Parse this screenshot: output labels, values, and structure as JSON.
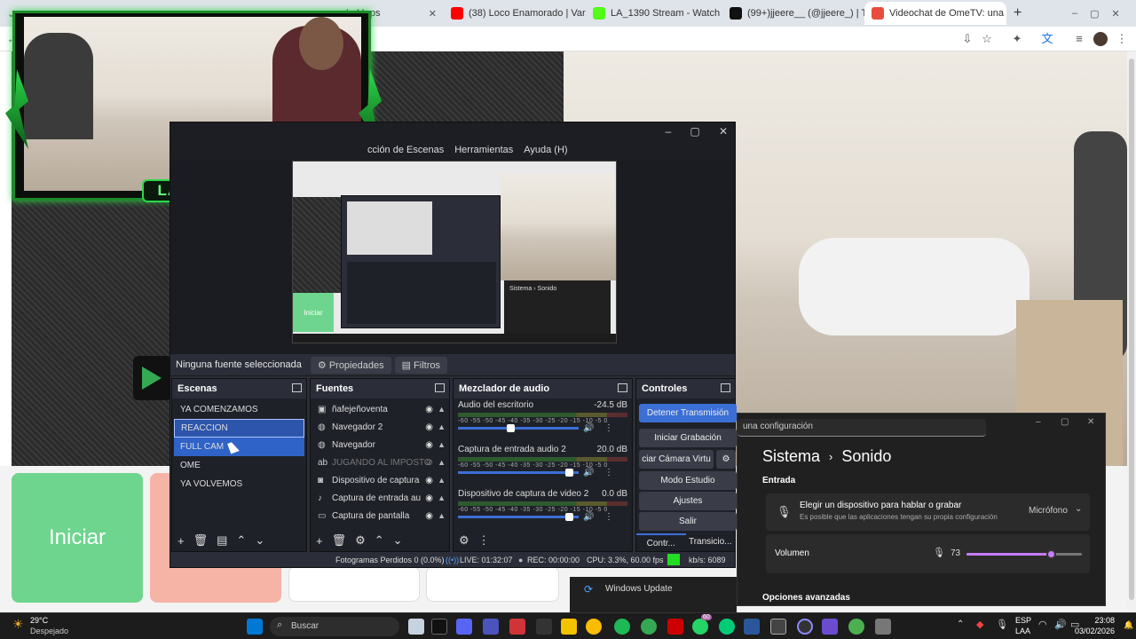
{
  "browser": {
    "tabs": [
      {
        "label": "le Maps",
        "color": "#1a73e8"
      },
      {
        "label": "(38) Loco Enamorado | Varieté",
        "color": "#ff0000"
      },
      {
        "label": "LA_1390 Stream - Watch Live o",
        "color": "#53fc18"
      },
      {
        "label": "(99+)jjeere__ (@jjeere_) | TikTo",
        "color": "#111111"
      },
      {
        "label": "Videochat de OmeTV: una",
        "color": "#e94b3c"
      }
    ],
    "new_tab": "+"
  },
  "page": {
    "iniciar_label": "Iniciar",
    "overlay_name": "LA_1390"
  },
  "obs": {
    "menu": [
      "cción de Escenas",
      "Herramientas",
      "Ayuda (H)"
    ],
    "preview_button": "Iniciar",
    "preview_window_title": "Sistema",
    "preview_window_page": "Sonido",
    "source_toolbar": {
      "none_selected": "Ninguna fuente seleccionada",
      "properties": "Propiedades",
      "filters": "Filtros"
    },
    "scenes": {
      "title": "Escenas",
      "items": [
        "YA COMENZAMOS",
        "REACCION",
        "FULL CAM",
        "OME",
        "YA VOLVEMOS"
      ]
    },
    "sources": {
      "title": "Fuentes",
      "items": [
        "ñafejeñoventa",
        "Navegador 2",
        "Navegador",
        "JUGANDO AL IMPOSTO",
        "Dispositivo de captura",
        "Captura de entrada au",
        "Captura de pantalla"
      ]
    },
    "mixer": {
      "title": "Mezclador de audio",
      "scale": "-60 -55 -50 -45 -40 -35 -30 -25 -20 -15 -10 -5 0",
      "channels": [
        {
          "name": "Audio del escritorio",
          "db": "-24.5 dB",
          "level": 0.43
        },
        {
          "name": "Captura de entrada audio 2",
          "db": "20.0 dB",
          "level": 0.95
        },
        {
          "name": "Dispositivo de captura de video 2",
          "db": "0.0 dB",
          "level": 0.95
        }
      ]
    },
    "controls": {
      "title": "Controles",
      "stop_stream": "Detener Transmisión",
      "start_recording": "Iniciar Grabación",
      "virtual_cam": "ciar Cámara Virtu",
      "studio_mode": "Modo Estudio",
      "settings": "Ajustes",
      "exit": "Salir",
      "tab_controls": "Contr...",
      "tab_transitions": "Transicio..."
    },
    "status": {
      "dropped": "Fotogramas Perdidos 0 (0.0%)",
      "live": "LIVE: 01:32:07",
      "rec": "REC: 00:00:00",
      "cpu": "CPU: 3.3%, 60.00 fps",
      "kbps": "kb/s: 6089"
    }
  },
  "settings": {
    "search": "una configuración",
    "breadcrumb_root": "Sistema",
    "breadcrumb_page": "Sonido",
    "section_input": "Entrada",
    "device_title": "Elegir un dispositivo para hablar o grabar",
    "device_sub": "Es posible que las aplicaciones tengan su propia configuración",
    "device_value": "Micrófono",
    "volume_label": "Volumen",
    "volume_value": "73",
    "volume_level": 0.73,
    "advanced": "Opciones avanzadas",
    "side_update": "Windows Update"
  },
  "taskbar": {
    "weather_temp": "29°C",
    "weather_desc": "Despejado",
    "search": "Buscar",
    "lang": "ESP",
    "lang2": "LAA",
    "time": "23:08",
    "date": "03/02/2026",
    "badge": "60"
  }
}
